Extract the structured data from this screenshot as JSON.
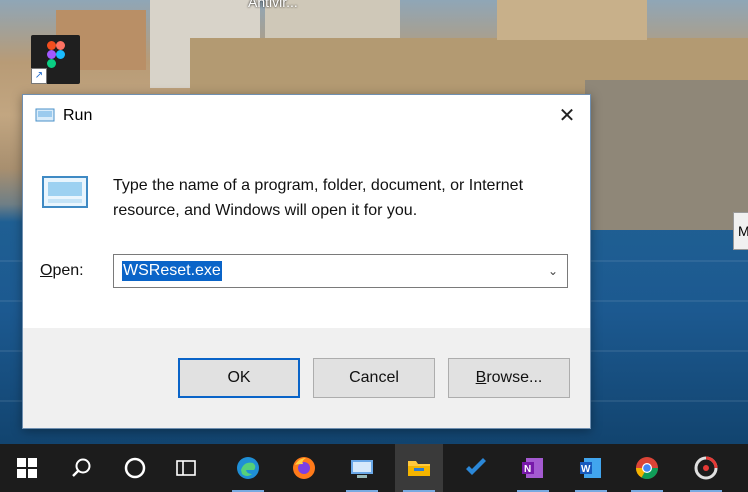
{
  "desktop": {
    "icon_label": "Antivir...",
    "side_tab_text": "M"
  },
  "dialog": {
    "title": "Run",
    "description": "Type the name of a program, folder, document, or Internet resource, and Windows will open it for you.",
    "open_label_first": "O",
    "open_label_rest": "pen:",
    "open_value": "WSReset.exe",
    "ok_label": "OK",
    "cancel_label": "Cancel",
    "browse_label_first": "B",
    "browse_label_rest": "rowse..."
  },
  "taskbar": {
    "items": [
      {
        "icon": "windows-start-icon"
      },
      {
        "icon": "search-icon"
      },
      {
        "icon": "cortana-icon"
      },
      {
        "icon": "task-view-icon"
      },
      {
        "icon": "edge-icon"
      },
      {
        "icon": "firefox-icon"
      },
      {
        "icon": "remote-desktop-icon"
      },
      {
        "icon": "file-explorer-icon"
      },
      {
        "icon": "todo-icon"
      },
      {
        "icon": "onenote-icon"
      },
      {
        "icon": "word-icon"
      },
      {
        "icon": "chrome-icon"
      },
      {
        "icon": "recording-icon"
      }
    ]
  },
  "colors": {
    "accent": "#0a64c8",
    "taskbar": "#1c1c1c"
  }
}
